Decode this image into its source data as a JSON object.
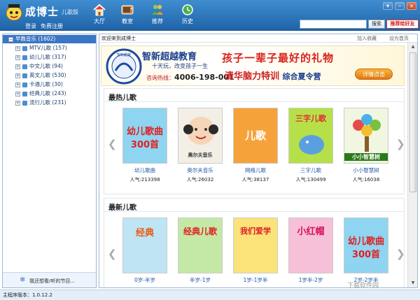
{
  "app": {
    "title": "成博士",
    "subtitle": "儿歌版",
    "login": "登录",
    "register": "免费注册"
  },
  "nav": [
    {
      "label": "大厅",
      "icon": "house-icon"
    },
    {
      "label": "教室",
      "icon": "tv-icon"
    },
    {
      "label": "推荐",
      "icon": "people-icon"
    },
    {
      "label": "历史",
      "icon": "history-icon"
    }
  ],
  "search": {
    "placeholder": "",
    "button": "搜索",
    "recommend": "推荐给好友"
  },
  "window_controls": [
    "▾",
    "–",
    "×"
  ],
  "sidebar": {
    "items": [
      {
        "label": "早教音乐 (1602)",
        "active": true
      },
      {
        "label": "MTV儿歌 (157)"
      },
      {
        "label": "幼儿儿歌 (317)"
      },
      {
        "label": "中文儿歌 (94)"
      },
      {
        "label": "英文儿歌 (530)"
      },
      {
        "label": "卡通儿歌 (30)"
      },
      {
        "label": "经典儿歌 (243)"
      },
      {
        "label": "流行儿歌 (231)"
      }
    ],
    "footer": "我还想看/听的节目..."
  },
  "main": {
    "welcome": "欢迎来到成博士",
    "add_favorite": "加入收藏",
    "set_homepage": "设为首页"
  },
  "banner": {
    "brand": "智新超越教育",
    "slogan": "十天玩，改变孩子一生",
    "hotline_label": "咨询热线：",
    "hotline": "4006-198-001",
    "headline": "孩子一辈子最好的礼物",
    "subline": "清华脑力特训",
    "subline2": "综合夏令营",
    "cta": "详情点击",
    "logo_text": "智新超越"
  },
  "hot": {
    "title": "最热儿歌",
    "albums": [
      {
        "title": "幼儿歌曲",
        "popularity": "人气:213398",
        "cover_text": "幼儿歌曲300首",
        "bg": "#8fd4f0",
        "fg": "#e02020"
      },
      {
        "title": "奥尔夫音乐",
        "popularity": "人气:26032",
        "cover_text": "奥尔夫音乐",
        "bg": "#f3efe6",
        "fg": "#333"
      },
      {
        "title": "网络儿歌",
        "popularity": "人气:38137",
        "cover_text": "儿歌",
        "bg": "#f6a23a",
        "fg": "#fff"
      },
      {
        "title": "三字儿歌",
        "popularity": "人气:130499",
        "cover_text": "三字儿歌",
        "bg": "#b6e04a",
        "fg": "#e03030"
      },
      {
        "title": "小小智慧树",
        "popularity": "人气:16038",
        "cover_text": "小小智慧树",
        "bg": "#f0f6e0",
        "fg": "#2a7a1a"
      }
    ]
  },
  "new": {
    "title": "最新儿歌",
    "albums": [
      {
        "title": "0岁-半岁",
        "cover_text": "经典",
        "bg": "#bfe4f4",
        "fg": "#e85a10"
      },
      {
        "title": "半岁-1岁",
        "cover_text": "经典儿歌",
        "bg": "#c4e8a6",
        "fg": "#e02020"
      },
      {
        "title": "1岁-1岁半",
        "cover_text": "我们爱学",
        "bg": "#fbe37a",
        "fg": "#d82020"
      },
      {
        "title": "1岁半-2岁",
        "cover_text": "小红帽",
        "bg": "#f5c0d8",
        "fg": "#d81060"
      },
      {
        "title": "2岁-2岁半",
        "cover_text": "幼儿歌曲300首",
        "bg": "#8fd4f0",
        "fg": "#e02020"
      }
    ]
  },
  "status": {
    "version": "主程序版本：1.0.12.2",
    "watermark": "下载软件园"
  }
}
